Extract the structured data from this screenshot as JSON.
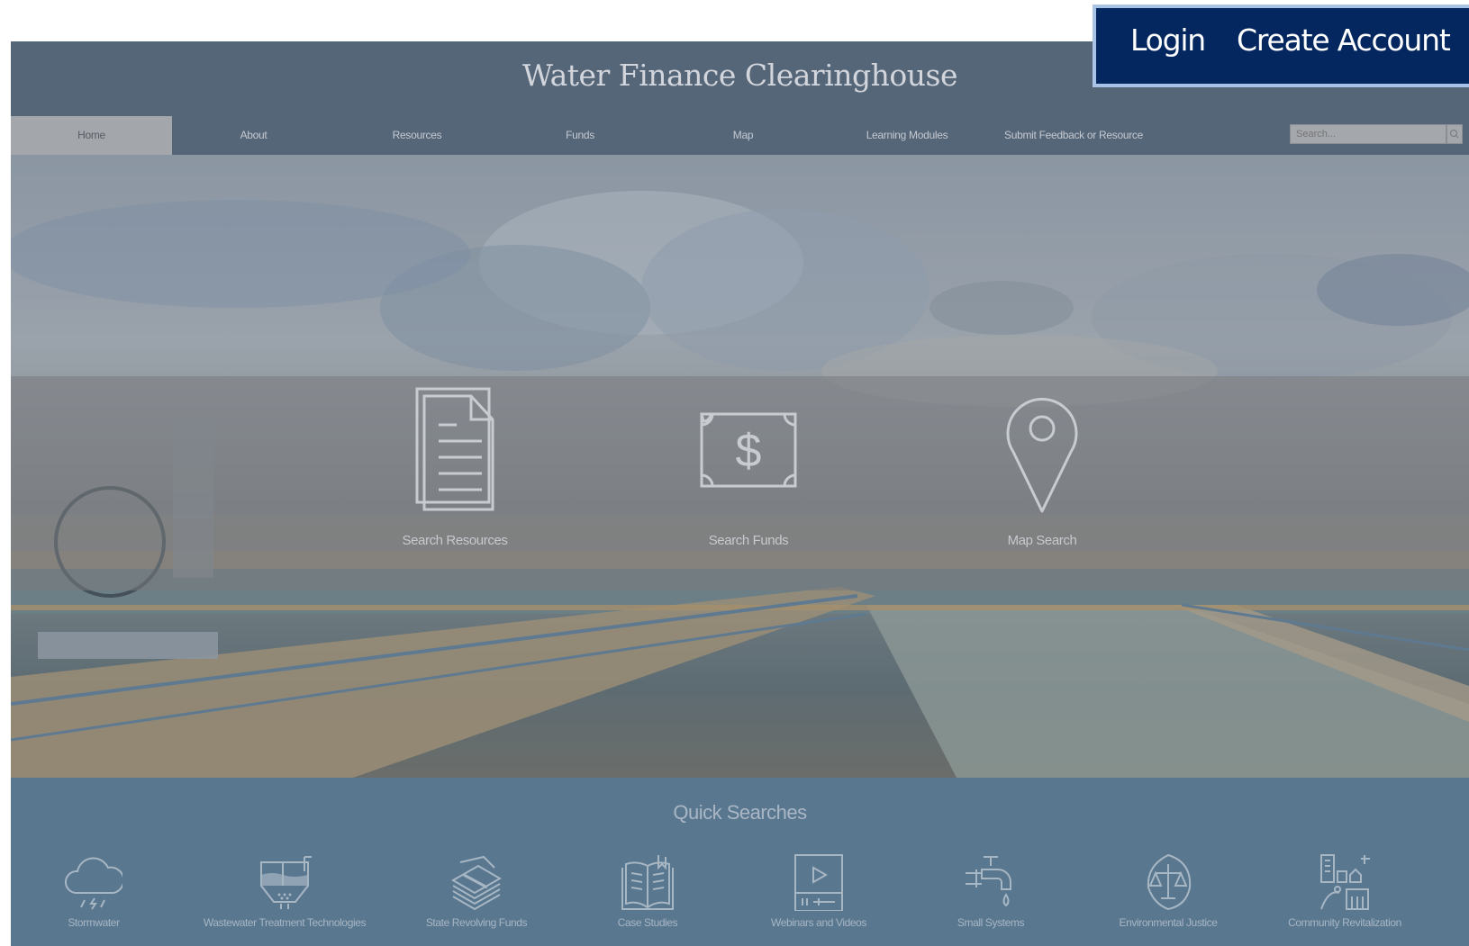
{
  "header": {
    "site_title": "Water Finance Clearinghouse"
  },
  "auth": {
    "login_label": "Login",
    "create_account_label": "Create Account"
  },
  "nav": {
    "items": [
      {
        "label": "Home",
        "active": true
      },
      {
        "label": "About"
      },
      {
        "label": "Resources"
      },
      {
        "label": "Funds"
      },
      {
        "label": "Map"
      },
      {
        "label": "Learning Modules"
      },
      {
        "label": "Submit Feedback or Resource"
      }
    ],
    "search_placeholder": "Search...",
    "search_icon": "magnifier-icon"
  },
  "hero": {
    "cards": [
      {
        "label": "Search Resources",
        "icon": "document-icon"
      },
      {
        "label": "Search Funds",
        "icon": "dollar-bill-icon"
      },
      {
        "label": "Map Search",
        "icon": "map-pin-icon"
      }
    ]
  },
  "quick_searches": {
    "title": "Quick Searches",
    "items": [
      {
        "label": "Stormwater",
        "icon": "rain-cloud-icon"
      },
      {
        "label": "Wastewater Treatment Technologies",
        "icon": "treatment-tank-icon"
      },
      {
        "label": "State Revolving Funds",
        "icon": "money-stack-icon"
      },
      {
        "label": "Case Studies",
        "icon": "open-book-icon"
      },
      {
        "label": "Webinars and Videos",
        "icon": "video-player-icon"
      },
      {
        "label": "Small Systems",
        "icon": "faucet-icon"
      },
      {
        "label": "Environmental Justice",
        "icon": "scales-leaf-icon"
      },
      {
        "label": "Community Revitalization",
        "icon": "city-buildings-icon"
      }
    ]
  },
  "colors": {
    "auth_background": "#05275f",
    "nav_background": "#566679",
    "quick_searches_background": "#5a7790"
  }
}
